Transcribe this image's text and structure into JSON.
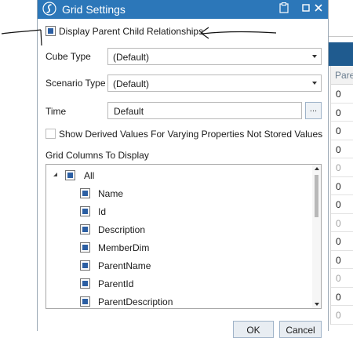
{
  "dialog": {
    "title": "Grid Settings",
    "display_parent_child_label": "Display Parent Child Relationships",
    "display_parent_child_checked": true,
    "cube_type_label": "Cube Type",
    "cube_type_value": "(Default)",
    "scenario_type_label": "Scenario Type",
    "scenario_type_value": "(Default)",
    "time_label": "Time",
    "time_value": "Default",
    "time_button": "...",
    "show_derived_label": "Show Derived Values For Varying Properties Not Stored Values",
    "show_derived_checked": false,
    "grid_columns_label": "Grid Columns To Display",
    "tree": {
      "root": "All",
      "children": [
        "Name",
        "Id",
        "Description",
        "MemberDim",
        "ParentName",
        "ParentId",
        "ParentDescription"
      ]
    },
    "ok_label": "OK",
    "cancel_label": "Cancel"
  },
  "background_grid": {
    "column_header": "Pare",
    "cells": [
      {
        "text": "0",
        "dim": false
      },
      {
        "text": "0",
        "dim": false
      },
      {
        "text": "0",
        "dim": false
      },
      {
        "text": "0",
        "dim": false
      },
      {
        "text": "0",
        "dim": true
      },
      {
        "text": "0",
        "dim": false
      },
      {
        "text": "0",
        "dim": false
      },
      {
        "text": "0",
        "dim": true
      },
      {
        "text": "0",
        "dim": false
      },
      {
        "text": "0",
        "dim": false
      },
      {
        "text": "0",
        "dim": true
      },
      {
        "text": "0",
        "dim": false
      },
      {
        "text": "0",
        "dim": true
      }
    ]
  },
  "colors": {
    "titlebar": "#2c77b9",
    "checkbox_fill": "#2c5fa3",
    "background_bar": "#1f5b8f"
  }
}
